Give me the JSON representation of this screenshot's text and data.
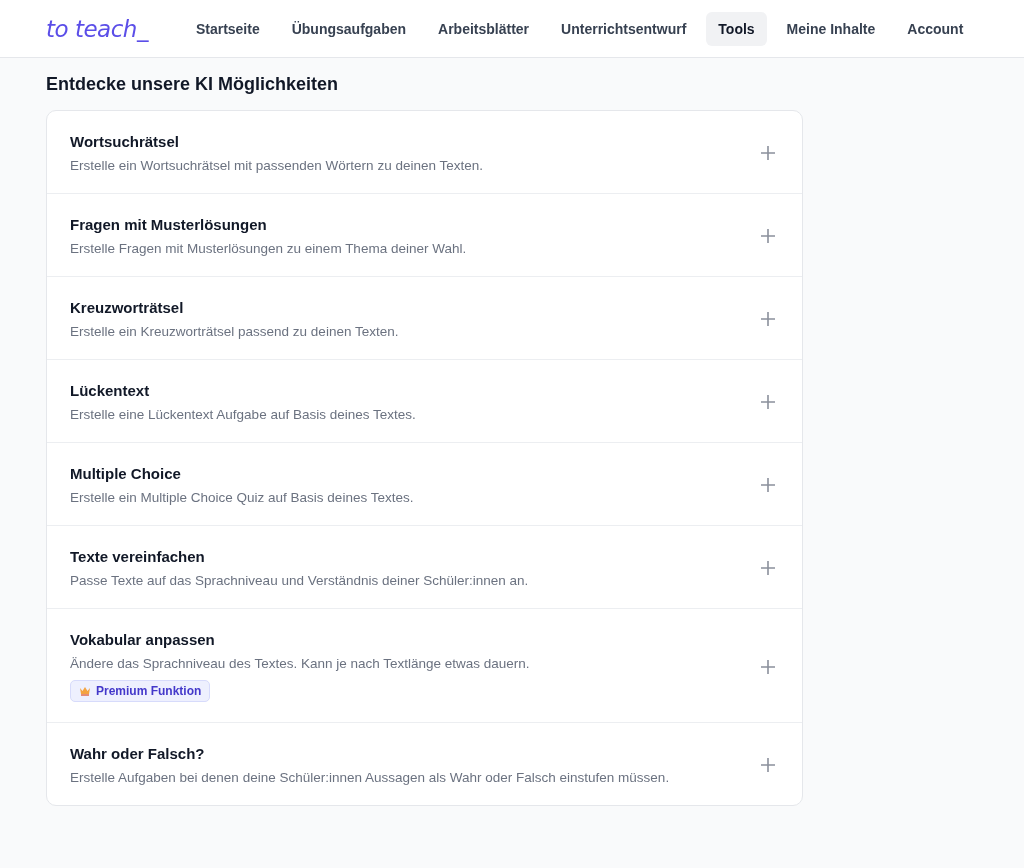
{
  "header": {
    "logo": "to teach_",
    "nav": [
      {
        "label": "Startseite",
        "selected": false
      },
      {
        "label": "Übungsaufgaben",
        "selected": false
      },
      {
        "label": "Arbeitsblätter",
        "selected": false
      },
      {
        "label": "Unterrichtsentwurf",
        "selected": false
      },
      {
        "label": "Tools",
        "selected": true
      },
      {
        "label": "Meine Inhalte",
        "selected": false
      },
      {
        "label": "Account",
        "selected": false
      }
    ]
  },
  "heading": "Entdecke unsere KI Möglichkeiten",
  "tools": [
    {
      "title": "Wortsuchrätsel",
      "description": "Erstelle ein Wortsuchrätsel mit passenden Wörtern zu deinen Texten.",
      "expanded": false
    },
    {
      "title": "Fragen mit Musterlösungen",
      "description": "Erstelle Fragen mit Musterlösungen zu einem Thema deiner Wahl.",
      "expanded": false
    },
    {
      "title": "Kreuzworträtsel",
      "description": "Erstelle ein Kreuzworträtsel passend zu deinen Texten.",
      "expanded": false
    },
    {
      "title": "Lückentext",
      "description": "Erstelle eine Lückentext Aufgabe auf Basis deines Textes.",
      "expanded": false
    },
    {
      "title": "Multiple Choice",
      "description": "Erstelle ein Multiple Choice Quiz auf Basis deines Textes.",
      "expanded": false
    },
    {
      "title": "Texte vereinfachen",
      "description": "Passe Texte auf das Sprachniveau und Verständnis deiner Schüler:innen an.",
      "expanded": false
    },
    {
      "title": "Vokabular anpassen",
      "description": "Ändere das Sprachniveau des Textes. Kann je nach Textlänge etwas dauern.",
      "badge": "Premium Funktion",
      "expanded": false
    },
    {
      "title": "Wahr oder Falsch?",
      "description": "Erstelle Aufgaben bei denen deine Schüler:innen Aussagen als Wahr oder Falsch einstufen müssen.",
      "expanded": false
    }
  ]
}
